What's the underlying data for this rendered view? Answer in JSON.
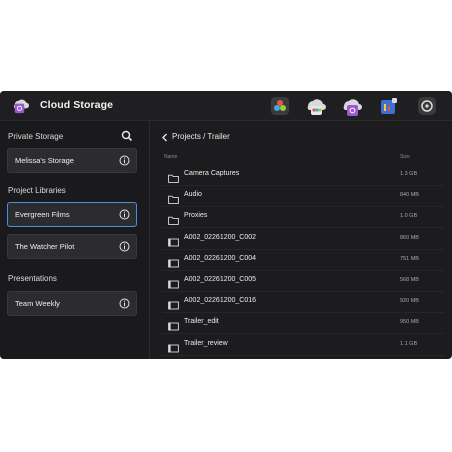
{
  "header": {
    "title": "Cloud Storage",
    "logo_icon": "cloud-storage-logo",
    "icons": [
      "davinci-resolve-icon",
      "cloud-team-icon",
      "cloud-storage-icon",
      "project-manager-icon",
      "settings-icon"
    ]
  },
  "sidebar": {
    "private_label": "Private Storage",
    "private_items": [
      {
        "label": "Melissa's Storage"
      }
    ],
    "libraries_label": "Project Libraries",
    "library_items": [
      {
        "label": "Evergreen Films",
        "selected": true
      },
      {
        "label": "The Watcher Pilot",
        "selected": false
      }
    ],
    "presentations_label": "Presentations",
    "presentation_items": [
      {
        "label": "Team Weekly"
      }
    ]
  },
  "main": {
    "breadcrumb": "Projects / Trailer",
    "columns": {
      "name": "Name",
      "size": "Size"
    },
    "rows": [
      {
        "name": "Camera Captures",
        "size": "1.3 GB",
        "type": "folder"
      },
      {
        "name": "Audio",
        "size": "840 MB",
        "type": "folder"
      },
      {
        "name": "Proxies",
        "size": "1.0 GB",
        "type": "folder"
      },
      {
        "name": "A002_02261200_C002",
        "size": "860 MB",
        "type": "clip"
      },
      {
        "name": "A002_02261200_C004",
        "size": "751 MB",
        "type": "clip"
      },
      {
        "name": "A002_02261200_C005",
        "size": "568 MB",
        "type": "clip"
      },
      {
        "name": "A002_02261200_C016",
        "size": "920 MB",
        "type": "clip"
      },
      {
        "name": "Trailer_edit",
        "size": "950 MB",
        "type": "clip"
      },
      {
        "name": "Trailer_review",
        "size": "1.1 GB",
        "type": "clip"
      }
    ]
  },
  "colors": {
    "accent": "#4a90e2",
    "background": "#1c1c1e",
    "card": "#2c2c2e"
  }
}
